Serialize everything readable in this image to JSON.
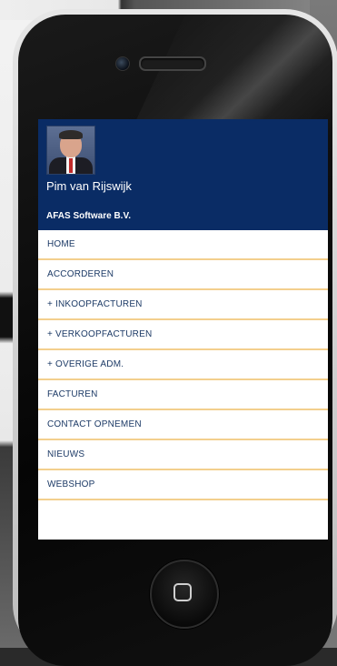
{
  "profile": {
    "name": "Pim van Rijswijk",
    "company": "AFAS Software B.V."
  },
  "menu": {
    "items": [
      "HOME",
      "ACCORDEREN",
      "+ INKOOPFACTUREN",
      "+ VERKOOPFACTUREN",
      "+ OVERIGE ADM.",
      "FACTUREN",
      "CONTACT OPNEMEN",
      "NIEUWS",
      "WEBSHOP"
    ]
  },
  "colors": {
    "header_bg": "#0a2c65",
    "menu_divider": "#f3cf8d",
    "menu_text": "#1c3a66"
  },
  "icons": {
    "home_button": "home-button-icon",
    "camera": "front-camera-icon",
    "speaker": "speaker-grille-icon"
  }
}
